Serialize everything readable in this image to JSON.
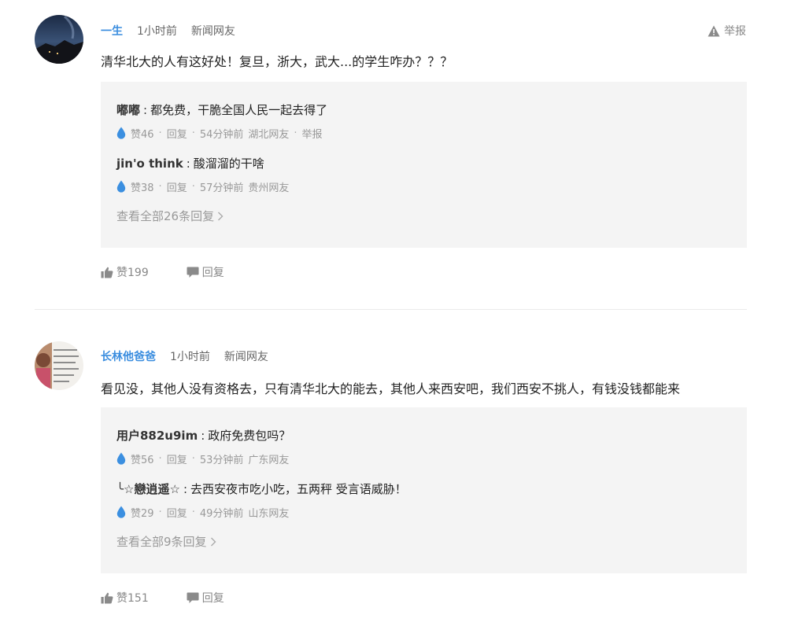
{
  "report_label": "举报",
  "comments": [
    {
      "username": "一生",
      "time": "1小时前",
      "source": "新闻网友",
      "content": "清华北大的人有这好处！复旦，浙大，武大...的学生咋办？？？",
      "replies": [
        {
          "name": "嘟嘟",
          "sep": ":",
          "text": "都免费，干脆全国人民一起去得了",
          "likes": "赞46",
          "reply_label": "回复",
          "time": "54分钟前",
          "region": "湖北网友",
          "report": "举报"
        },
        {
          "name": "jin'o think",
          "sep": ":",
          "text": "酸溜溜的干啥",
          "likes": "赞38",
          "reply_label": "回复",
          "time": "57分钟前",
          "region": "贵州网友"
        }
      ],
      "view_all": "查看全部26条回复",
      "like_label": "赞199",
      "reply_label": "回复"
    },
    {
      "username": "长林他爸爸",
      "time": "1小时前",
      "source": "新闻网友",
      "content": "看见没，其他人没有资格去，只有清华北大的能去，其他人来西安吧，我们西安不挑人，有钱没钱都能来",
      "replies": [
        {
          "name": "用户882u9im",
          "sep": ":",
          "text": "政府免费包吗？",
          "likes": "赞56",
          "reply_label": "回复",
          "time": "53分钟前",
          "region": "广东网友"
        },
        {
          "name": "╰☆戀逍遥☆",
          "sep": ":",
          "text": "去西安夜市吃小吃，五两秤 受言语威胁！",
          "likes": "赞29",
          "reply_label": "回复",
          "time": "49分钟前",
          "region": "山东网友"
        }
      ],
      "view_all": "查看全部9条回复",
      "like_label": "赞151",
      "reply_label": "回复"
    }
  ],
  "icons": {
    "like": "thumbs-up-icon",
    "reply": "speech-bubble-icon",
    "report": "warning-triangle-icon",
    "reply_like": "water-drop-icon",
    "view_all": "chevron-right-icon"
  },
  "colors": {
    "username": "#3a8ddf",
    "drop": "#3b8fe0",
    "reply_bg": "#f4f4f4",
    "muted": "#999999"
  }
}
